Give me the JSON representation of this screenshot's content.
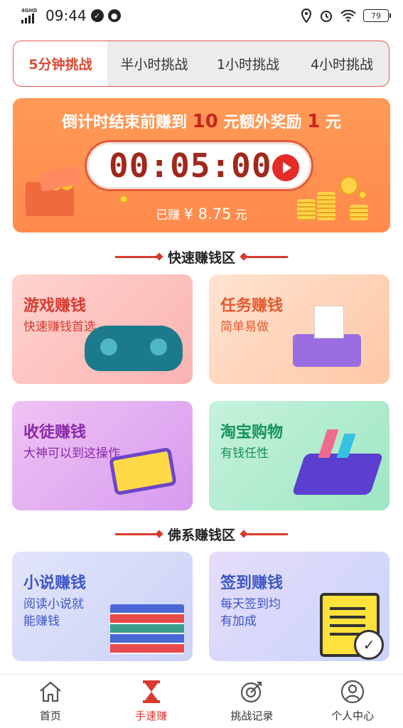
{
  "status_bar": {
    "network": "4GHD",
    "time": "09:44",
    "battery": "79"
  },
  "tabs": [
    {
      "label": "5分钟挑战",
      "active": true
    },
    {
      "label": "半小时挑战",
      "active": false
    },
    {
      "label": "1小时挑战",
      "active": false
    },
    {
      "label": "4小时挑战",
      "active": false
    }
  ],
  "banner": {
    "title_pre": "倒计时结束前赚到",
    "target": "10",
    "title_mid": "元额外奖励",
    "bonus": "1",
    "title_post": "元",
    "timer": "00:05:00",
    "earned_label": "已赚",
    "earned_value": "¥ 8.75",
    "earned_unit": "元"
  },
  "sections": {
    "quick": "快速赚钱区",
    "buddha": "佛系赚钱区"
  },
  "cards": {
    "game": {
      "title": "游戏赚钱",
      "subtitle": "快速赚钱首选"
    },
    "task": {
      "title": "任务赚钱",
      "subtitle": "简单易做"
    },
    "recruit": {
      "title": "收徒赚钱",
      "subtitle": "大神可以到这操作"
    },
    "taobao": {
      "title": "淘宝购物",
      "subtitle": "有钱任性"
    },
    "novel": {
      "title": "小说赚钱",
      "subtitle_1": "阅读小说就",
      "subtitle_2": "能赚钱"
    },
    "sign": {
      "title": "签到赚钱",
      "subtitle_1": "每天签到均",
      "subtitle_2": "有加成"
    }
  },
  "nav": [
    {
      "label": "首页",
      "icon": "home-icon",
      "active": false
    },
    {
      "label": "手速赚",
      "icon": "hourglass-icon",
      "active": true
    },
    {
      "label": "挑战记录",
      "icon": "target-icon",
      "active": false
    },
    {
      "label": "个人中心",
      "icon": "person-icon",
      "active": false
    }
  ],
  "colors": {
    "accent": "#d83a2e",
    "banner": "#ff9052"
  }
}
